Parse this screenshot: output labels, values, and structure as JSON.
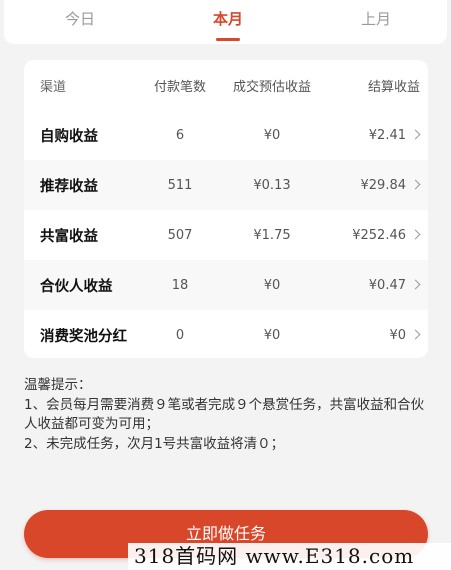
{
  "tabs": [
    {
      "label": "今日",
      "active": false
    },
    {
      "label": "本月",
      "active": true
    },
    {
      "label": "上月",
      "active": false
    }
  ],
  "table": {
    "headers": {
      "channel": "渠道",
      "count": "付款笔数",
      "estimate": "成交预估收益",
      "settle": "结算收益"
    },
    "rows": [
      {
        "channel": "自购收益",
        "count": "6",
        "estimate": "¥0",
        "settle": "¥2.41"
      },
      {
        "channel": "推荐收益",
        "count": "511",
        "estimate": "¥0.13",
        "settle": "¥29.84"
      },
      {
        "channel": "共富收益",
        "count": "507",
        "estimate": "¥1.75",
        "settle": "¥252.46"
      },
      {
        "channel": "合伙人收益",
        "count": "18",
        "estimate": "¥0",
        "settle": "¥0.47"
      },
      {
        "channel": "消费奖池分红",
        "count": "0",
        "estimate": "¥0",
        "settle": "¥0"
      }
    ]
  },
  "tips": {
    "title": "温馨提示：",
    "line1": "1、会员每月需要消费９笔或者完成９个悬赏任务，共富收益和合伙人收益都可变为可用；",
    "line2": "2、未完成任务，次月1号共富收益将清０；"
  },
  "cta": {
    "label": "立即做任务"
  },
  "watermark": {
    "text": "318首码网 www.E318.com"
  },
  "colors": {
    "accent": "#d9472a",
    "background": "#f3f3f3",
    "card": "#ffffff"
  }
}
